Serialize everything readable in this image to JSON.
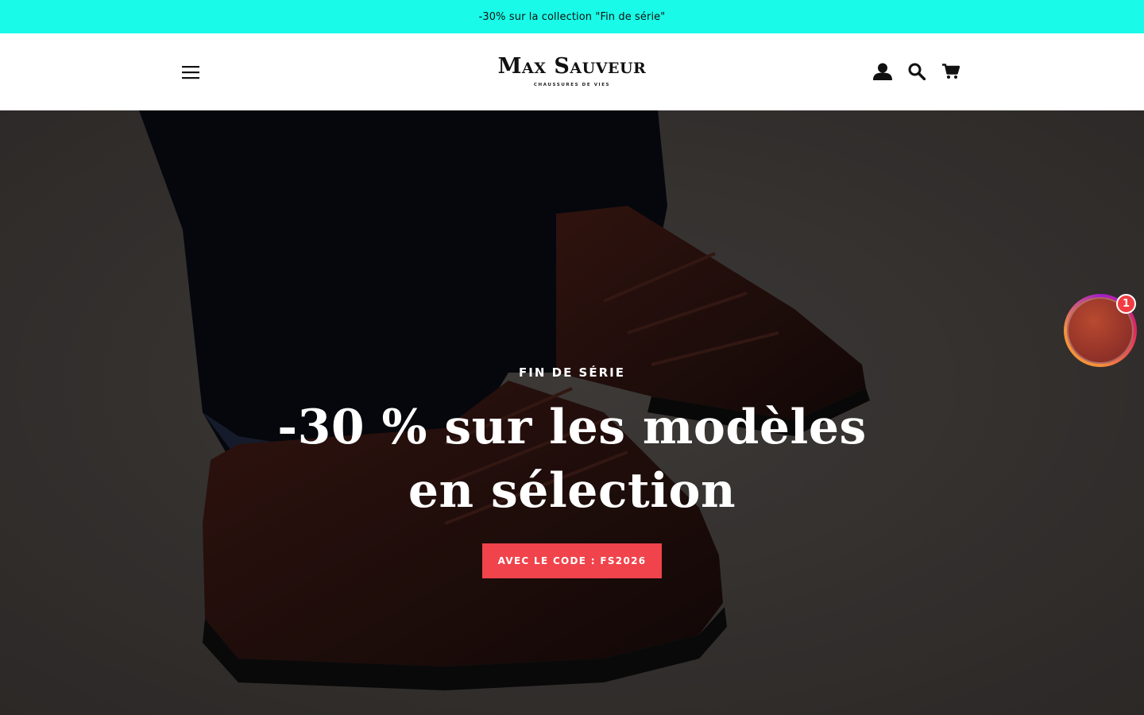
{
  "announcement": {
    "text": "-30% sur la collection \"Fin de série\""
  },
  "header": {
    "logo": {
      "name": "Max Sauveur",
      "tagline": "CHAUSSURES DE VIES"
    },
    "icons": [
      "menu-icon",
      "user-icon",
      "search-icon",
      "cart-icon"
    ]
  },
  "hero": {
    "subtitle": "FIN DE SÉRIE",
    "title": "-30 % sur les modèles en sélection",
    "button_label": "AVEC LE CODE : FS2026"
  },
  "chat_widget": {
    "badge_count": "1"
  },
  "colors": {
    "announcement_bg": "#19fbe8",
    "button_bg": "#f0434b",
    "badge_bg": "#f13d42"
  }
}
